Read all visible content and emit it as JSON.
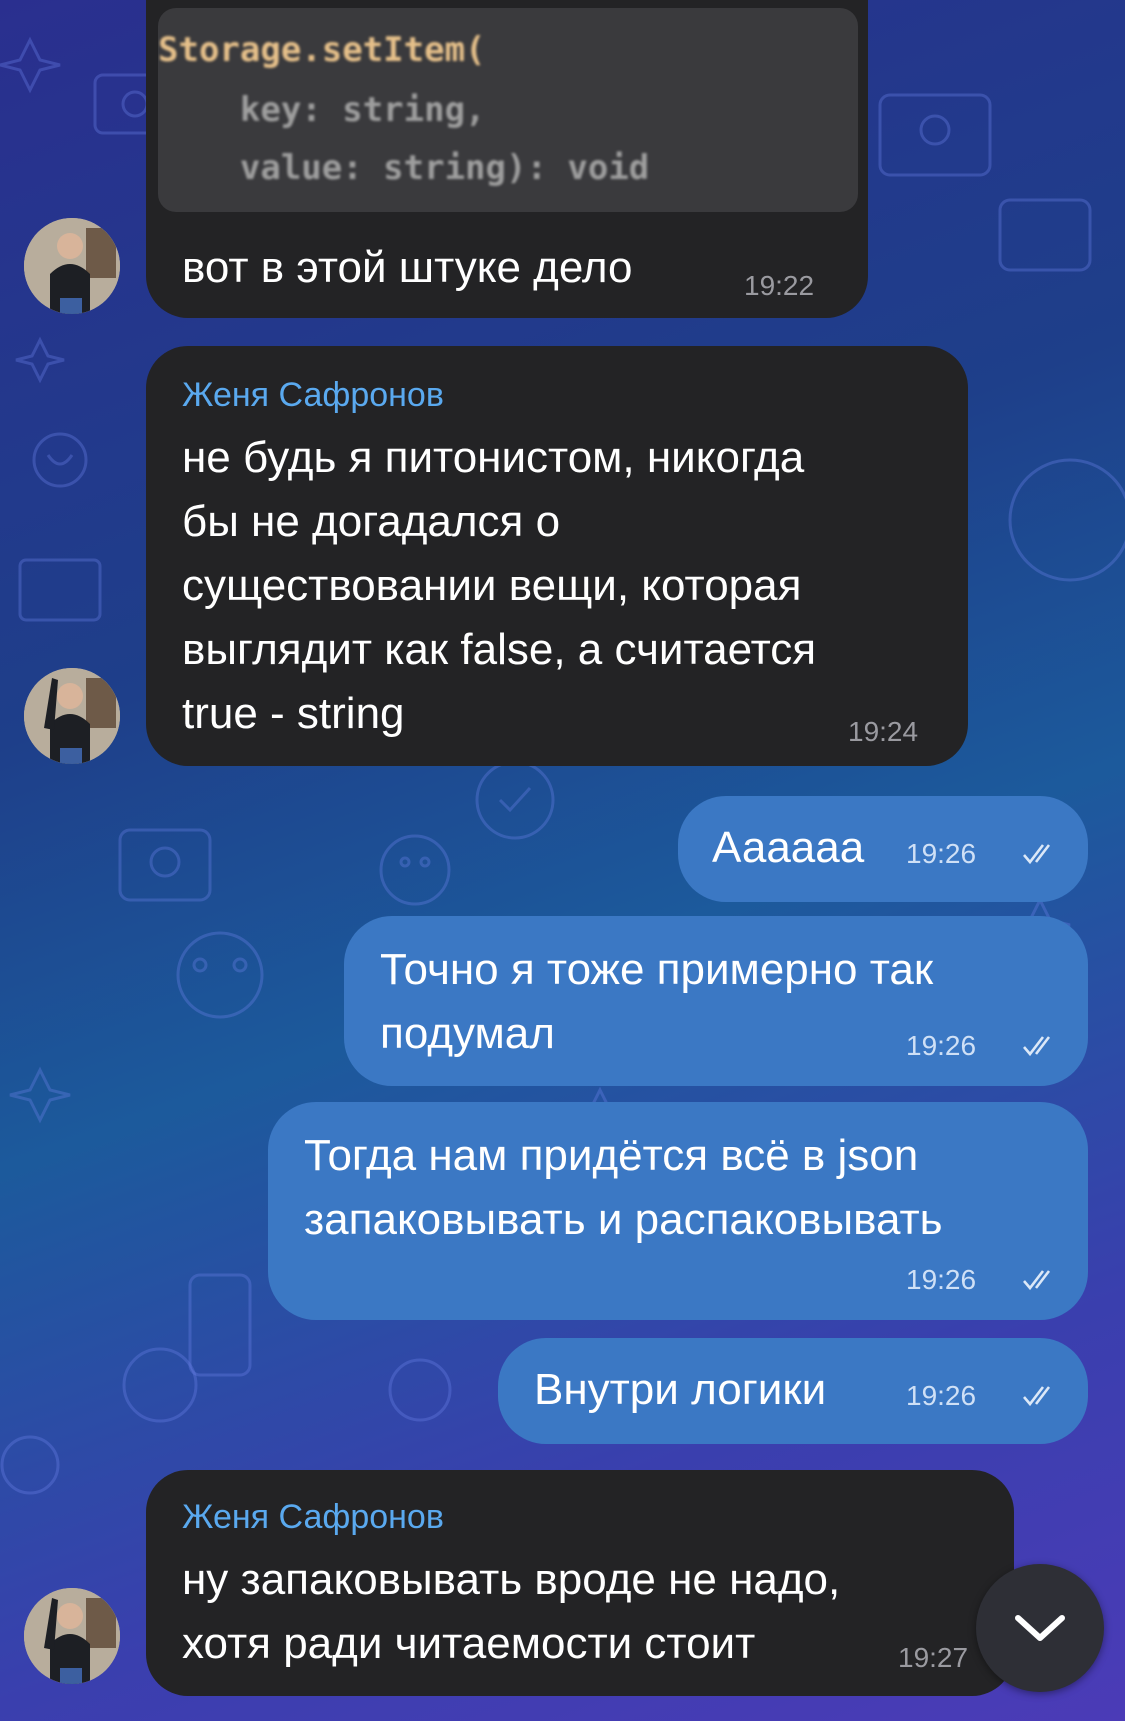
{
  "colors": {
    "incoming_bubble": "#232325",
    "outgoing_bubble": "#3b78c4",
    "sender_name": "#5aa9ef"
  },
  "messages": [
    {
      "direction": "incoming",
      "code_snippet": [
        "Storage.setItem(",
        "    key: string,",
        "    value: string): void"
      ],
      "text": "вот в этой штуке дело",
      "time": "19:22"
    },
    {
      "direction": "incoming",
      "sender": "Женя Сафронов",
      "text_lines": [
        "не будь я питонистом, никогда",
        "бы не догадался о",
        "существовании вещи, которая",
        "выглядит как false, а считается",
        "true - string"
      ],
      "time": "19:24"
    },
    {
      "direction": "outgoing",
      "text": "Аааааа",
      "time": "19:26",
      "status": "read"
    },
    {
      "direction": "outgoing",
      "text_lines": [
        "Точно я тоже примерно так",
        "подумал"
      ],
      "time": "19:26",
      "status": "read"
    },
    {
      "direction": "outgoing",
      "text_lines": [
        "Тогда нам придётся всё в json",
        "запаковывать и распаковывать"
      ],
      "time": "19:26",
      "status": "read"
    },
    {
      "direction": "outgoing",
      "text": "Внутри логики",
      "time": "19:26",
      "status": "read"
    },
    {
      "direction": "incoming",
      "sender": "Женя Сафронов",
      "text_lines": [
        "ну запаковывать вроде не надо,",
        "хотя ради читаемости стоит"
      ],
      "time": "19:27"
    }
  ],
  "scroll_button": {
    "icon": "chevron-down-icon"
  },
  "avatar_icon": "user-photo"
}
